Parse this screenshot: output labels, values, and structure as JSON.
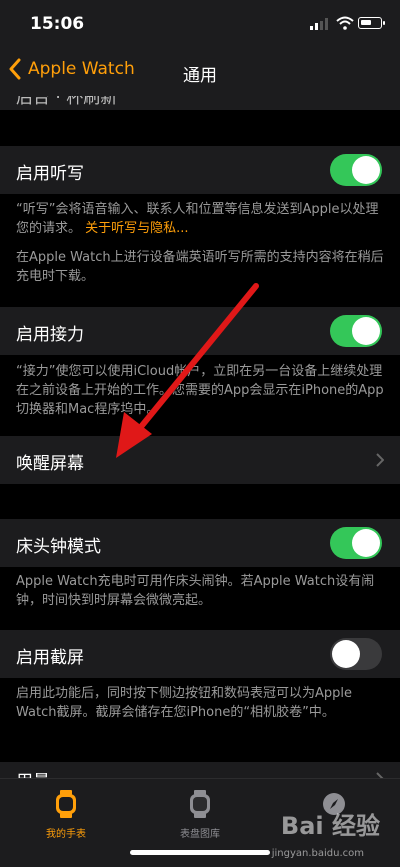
{
  "status": {
    "time": "15:06"
  },
  "nav": {
    "back_label": "Apple Watch",
    "title": "通用",
    "partial_top": "后台 · 杯刷新"
  },
  "rows": {
    "dictation": {
      "label": "启用听写",
      "footer_text": "“听写”会将语音输入、联系人和位置等信息发送到Apple以处理您的请求。",
      "footer_link": "关于听写与隐私...",
      "footer_text2": "在Apple Watch上进行设备端英语听写所需的支持内容将在稍后充电时下载。",
      "toggle": "on"
    },
    "handoff": {
      "label": "启用接力",
      "footer": "“接力”使您可以使用iCloud帐户，立即在另一台设备上继续处理在之前设备上开始的工作。您需要的App会显示在iPhone的App切换器和Mac程序坞中。",
      "toggle": "on"
    },
    "wake": {
      "label": "唤醒屏幕"
    },
    "nightstand": {
      "label": "床头钟模式",
      "footer": "Apple Watch充电时可用作床头闹钟。若Apple Watch设有闹钟，时间快到时屏幕会微微亮起。",
      "toggle": "on"
    },
    "screenshot": {
      "label": "启用截屏",
      "footer": "启用此功能后，同时按下侧边按钮和数码表冠可以为Apple Watch截屏。截屏会储存在您iPhone的“相机胶卷”中。",
      "toggle": "off"
    },
    "usage": {
      "label": "用量"
    }
  },
  "tabs": [
    {
      "label": "我的手表"
    },
    {
      "label": "表盘图库"
    },
    {
      "label": ""
    }
  ],
  "watermark": {
    "text": "Bai 经验",
    "url": "jingyan.baidu.com"
  },
  "colors": {
    "accent": "#ff9f0a",
    "switch_on": "#34c759",
    "cell": "#1c1c1e"
  }
}
